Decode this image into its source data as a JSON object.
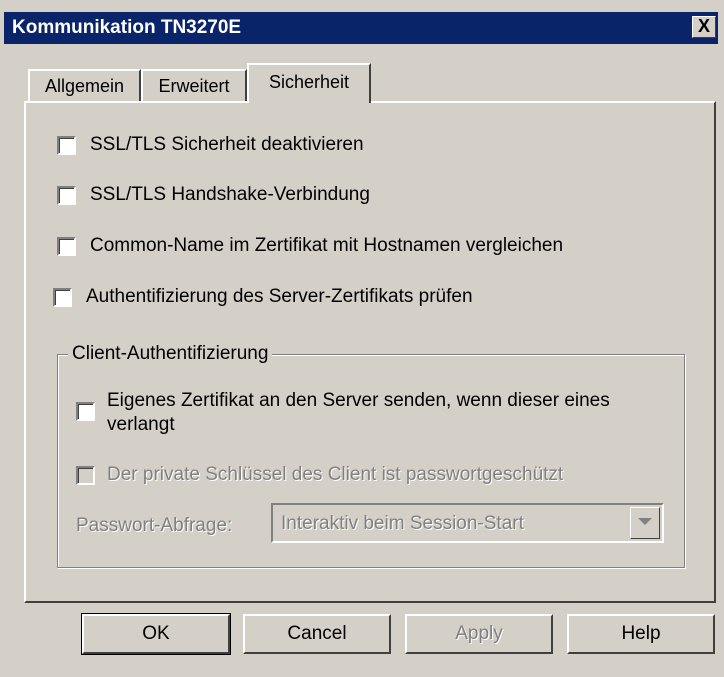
{
  "window": {
    "title": "Kommunikation TN3270E",
    "close_glyph": "X"
  },
  "tabs": [
    {
      "label": "Allgemein",
      "active": false
    },
    {
      "label": "Erweitert",
      "active": false
    },
    {
      "label": "Sicherheit",
      "active": true
    }
  ],
  "options": {
    "ssl_disable": {
      "label": "SSL/TLS Sicherheit deaktivieren",
      "checked": false
    },
    "ssl_handshake": {
      "label": "SSL/TLS Handshake-Verbindung",
      "checked": false
    },
    "common_name": {
      "label": "Common-Name im Zertifikat mit Hostnamen vergleichen",
      "checked": false
    },
    "server_auth": {
      "label": "Authentifizierung des Server-Zertifikats prüfen",
      "checked": false
    }
  },
  "client_auth": {
    "legend": "Client-Authentifizierung",
    "send_cert": {
      "label": "Eigenes Zertifikat an den Server senden, wenn dieser eines verlangt",
      "checked": false
    },
    "private_key": {
      "label": "Der private Schlüssel des Client ist passwortgeschützt",
      "checked": false,
      "enabled": false
    },
    "password_prompt": {
      "label": "Passwort-Abfrage:",
      "value": "Interaktiv beim Session-Start",
      "enabled": false
    }
  },
  "buttons": {
    "ok": "OK",
    "cancel": "Cancel",
    "apply": "Apply",
    "help": "Help"
  },
  "colors": {
    "face": "#d4d0c8",
    "title_bar": "#0a246a",
    "disabled_text": "#808080"
  }
}
